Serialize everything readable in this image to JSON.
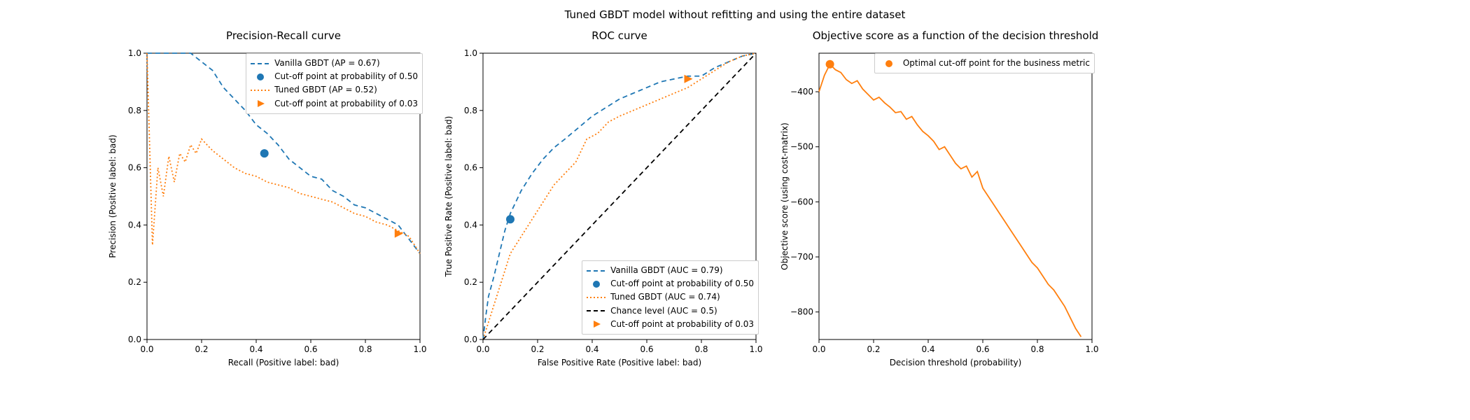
{
  "suptitle": "Tuned GBDT model without refitting and using the entire dataset",
  "panels": {
    "pr": {
      "title": "Precision-Recall curve",
      "xlabel": "Recall (Positive label: bad)",
      "ylabel": "Precision (Positive label: bad)",
      "legend": {
        "l0": "Vanilla GBDT (AP = 0.67)",
        "l1": "Cut-off point at probability of 0.50",
        "l2": "Tuned GBDT (AP = 0.52)",
        "l3": "Cut-off point at probability of 0.03"
      }
    },
    "roc": {
      "title": "ROC curve",
      "xlabel": "False Positive Rate (Positive label: bad)",
      "ylabel": "True Positive Rate (Positive label: bad)",
      "legend": {
        "l0": "Vanilla GBDT (AUC = 0.79)",
        "l1": "Cut-off point at probability of 0.50",
        "l2": "Tuned GBDT (AUC = 0.74)",
        "l3": "Chance level (AUC = 0.5)",
        "l4": "Cut-off point at probability of 0.03"
      }
    },
    "obj": {
      "title": "Objective score as a function of the decision threshold",
      "xlabel": "Decision threshold (probability)",
      "ylabel": "Objective score (using cost-matrix)",
      "legend": {
        "l0": "Optimal cut-off point for the business metric"
      }
    }
  },
  "ticks": {
    "unit_x": [
      "0.0",
      "0.2",
      "0.4",
      "0.6",
      "0.8",
      "1.0"
    ],
    "unit_y": [
      "0.0",
      "0.2",
      "0.4",
      "0.6",
      "0.8",
      "1.0"
    ],
    "obj_y": [
      "−800",
      "−700",
      "−600",
      "−500",
      "−400"
    ]
  },
  "chart_data": [
    {
      "type": "line",
      "id": "precision_recall",
      "title": "Precision-Recall curve",
      "xlabel": "Recall (Positive label: bad)",
      "ylabel": "Precision (Positive label: bad)",
      "xlim": [
        0.0,
        1.0
      ],
      "ylim": [
        0.0,
        1.0
      ],
      "series": [
        {
          "name": "Vanilla GBDT (AP = 0.67)",
          "style": "dashed",
          "color": "#1f77b4",
          "x": [
            0.0,
            0.05,
            0.08,
            0.12,
            0.16,
            0.2,
            0.24,
            0.28,
            0.32,
            0.36,
            0.4,
            0.44,
            0.48,
            0.52,
            0.56,
            0.6,
            0.64,
            0.68,
            0.72,
            0.76,
            0.8,
            0.84,
            0.88,
            0.92,
            0.96,
            1.0
          ],
          "y": [
            1.0,
            1.0,
            1.0,
            1.0,
            1.0,
            0.97,
            0.94,
            0.88,
            0.84,
            0.8,
            0.75,
            0.72,
            0.68,
            0.63,
            0.6,
            0.57,
            0.56,
            0.52,
            0.5,
            0.47,
            0.46,
            0.44,
            0.42,
            0.4,
            0.35,
            0.3
          ]
        },
        {
          "name": "Tuned GBDT (AP = 0.52)",
          "style": "dotted",
          "color": "#ff7f0e",
          "x": [
            0.0,
            0.02,
            0.04,
            0.06,
            0.08,
            0.1,
            0.12,
            0.14,
            0.16,
            0.18,
            0.2,
            0.24,
            0.28,
            0.32,
            0.36,
            0.4,
            0.44,
            0.48,
            0.52,
            0.56,
            0.6,
            0.64,
            0.68,
            0.72,
            0.76,
            0.8,
            0.84,
            0.88,
            0.92,
            0.96,
            1.0
          ],
          "y": [
            1.0,
            0.33,
            0.6,
            0.5,
            0.64,
            0.55,
            0.65,
            0.62,
            0.68,
            0.65,
            0.7,
            0.66,
            0.63,
            0.6,
            0.58,
            0.57,
            0.55,
            0.54,
            0.53,
            0.51,
            0.5,
            0.49,
            0.48,
            0.46,
            0.44,
            0.43,
            0.41,
            0.4,
            0.38,
            0.36,
            0.3
          ]
        }
      ],
      "markers": [
        {
          "name": "Cut-off point at probability of 0.50",
          "shape": "circle",
          "color": "#1f77b4",
          "x": 0.43,
          "y": 0.65
        },
        {
          "name": "Cut-off point at probability of 0.03",
          "shape": "triangle-right",
          "color": "#ff7f0e",
          "x": 0.92,
          "y": 0.37
        }
      ]
    },
    {
      "type": "line",
      "id": "roc",
      "title": "ROC curve",
      "xlabel": "False Positive Rate (Positive label: bad)",
      "ylabel": "True Positive Rate (Positive label: bad)",
      "xlim": [
        0.0,
        1.0
      ],
      "ylim": [
        0.0,
        1.0
      ],
      "series": [
        {
          "name": "Vanilla GBDT (AUC = 0.79)",
          "style": "dashed",
          "color": "#1f77b4",
          "x": [
            0.0,
            0.01,
            0.02,
            0.04,
            0.06,
            0.08,
            0.1,
            0.12,
            0.14,
            0.18,
            0.22,
            0.26,
            0.3,
            0.35,
            0.4,
            0.45,
            0.5,
            0.55,
            0.6,
            0.65,
            0.7,
            0.75,
            0.8,
            0.85,
            0.9,
            0.95,
            1.0
          ],
          "y": [
            0.0,
            0.08,
            0.15,
            0.22,
            0.3,
            0.38,
            0.44,
            0.48,
            0.52,
            0.58,
            0.63,
            0.67,
            0.7,
            0.74,
            0.78,
            0.81,
            0.84,
            0.86,
            0.88,
            0.9,
            0.91,
            0.92,
            0.92,
            0.95,
            0.97,
            0.99,
            1.0
          ]
        },
        {
          "name": "Tuned GBDT (AUC = 0.74)",
          "style": "dotted",
          "color": "#ff7f0e",
          "x": [
            0.0,
            0.02,
            0.04,
            0.06,
            0.08,
            0.1,
            0.14,
            0.18,
            0.22,
            0.26,
            0.3,
            0.34,
            0.38,
            0.42,
            0.46,
            0.5,
            0.55,
            0.6,
            0.65,
            0.7,
            0.75,
            0.8,
            0.85,
            0.9,
            0.95,
            1.0
          ],
          "y": [
            0.0,
            0.06,
            0.12,
            0.18,
            0.24,
            0.3,
            0.36,
            0.42,
            0.48,
            0.54,
            0.58,
            0.62,
            0.7,
            0.72,
            0.76,
            0.78,
            0.8,
            0.82,
            0.84,
            0.86,
            0.88,
            0.91,
            0.94,
            0.97,
            0.99,
            1.0
          ]
        },
        {
          "name": "Chance level (AUC = 0.5)",
          "style": "dashed",
          "color": "#000000",
          "x": [
            0.0,
            1.0
          ],
          "y": [
            0.0,
            1.0
          ]
        }
      ],
      "markers": [
        {
          "name": "Cut-off point at probability of 0.50",
          "shape": "circle",
          "color": "#1f77b4",
          "x": 0.1,
          "y": 0.42
        },
        {
          "name": "Cut-off point at probability of 0.03",
          "shape": "triangle-right",
          "color": "#ff7f0e",
          "x": 0.75,
          "y": 0.91
        }
      ]
    },
    {
      "type": "line",
      "id": "objective_score",
      "title": "Objective score as a function of the decision threshold",
      "xlabel": "Decision threshold (probability)",
      "ylabel": "Objective score (using cost-matrix)",
      "xlim": [
        0.0,
        1.0
      ],
      "ylim": [
        -850,
        -330
      ],
      "series": [
        {
          "name": "Objective score",
          "style": "solid",
          "color": "#ff7f0e",
          "x": [
            0.0,
            0.02,
            0.04,
            0.06,
            0.08,
            0.1,
            0.12,
            0.14,
            0.16,
            0.18,
            0.2,
            0.22,
            0.24,
            0.26,
            0.28,
            0.3,
            0.32,
            0.34,
            0.36,
            0.38,
            0.4,
            0.42,
            0.44,
            0.46,
            0.48,
            0.5,
            0.52,
            0.54,
            0.56,
            0.58,
            0.6,
            0.62,
            0.64,
            0.66,
            0.68,
            0.7,
            0.72,
            0.74,
            0.76,
            0.78,
            0.8,
            0.82,
            0.84,
            0.86,
            0.88,
            0.9,
            0.92,
            0.94,
            0.96
          ],
          "y": [
            -400,
            -370,
            -350,
            -360,
            -365,
            -378,
            -385,
            -380,
            -395,
            -405,
            -415,
            -410,
            -420,
            -428,
            -438,
            -436,
            -450,
            -445,
            -460,
            -472,
            -480,
            -490,
            -505,
            -500,
            -515,
            -530,
            -540,
            -535,
            -555,
            -545,
            -575,
            -590,
            -605,
            -620,
            -635,
            -650,
            -665,
            -680,
            -695,
            -710,
            -720,
            -735,
            -750,
            -760,
            -775,
            -790,
            -810,
            -830,
            -845
          ]
        }
      ],
      "markers": [
        {
          "name": "Optimal cut-off point for the business metric",
          "shape": "circle",
          "color": "#ff7f0e",
          "x": 0.04,
          "y": -350
        }
      ]
    }
  ]
}
